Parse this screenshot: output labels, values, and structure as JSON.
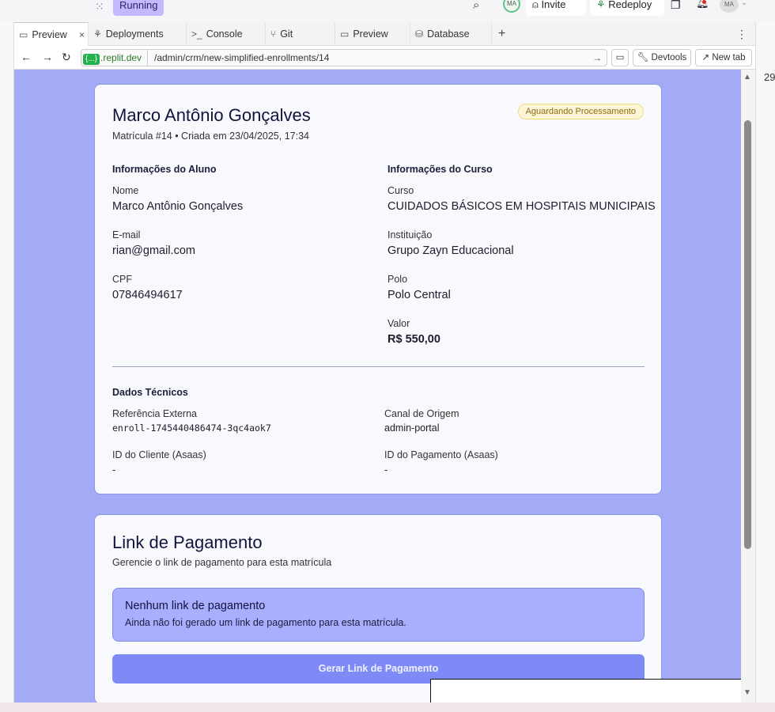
{
  "app": {
    "running_label": "Running",
    "avatar_initials": "MA",
    "invite_label": "Invite",
    "redeploy_label": "Redeploy"
  },
  "tabs": [
    {
      "label": "Preview",
      "icon": "monitor-icon",
      "active": true
    },
    {
      "label": "Deployments",
      "icon": "deploy-icon"
    },
    {
      "label": "Console",
      "icon": "terminal-icon"
    },
    {
      "label": "Git",
      "icon": "git-icon"
    },
    {
      "label": "Preview",
      "icon": "monitor-icon"
    },
    {
      "label": "Database",
      "icon": "database-icon"
    }
  ],
  "addressbar": {
    "domain_badge": "{...}",
    "domain": ".replit.dev",
    "path": "/admin/crm/new-simplified-enrollments/14",
    "devtools_label": "Devtools",
    "newtab_label": "New tab"
  },
  "side": {
    "right_number": "29"
  },
  "enrollment": {
    "student_name": "Marco Antônio Gonçalves",
    "subtitle": "Matrícula #14 • Criada em 23/04/2025, 17:34",
    "status": "Aguardando Processamento",
    "student_section": "Informações do Aluno",
    "course_section": "Informações do Curso",
    "name_label": "Nome",
    "name_value": "Marco Antônio Gonçalves",
    "email_label": "E-mail",
    "email_value": "rian@gmail.com",
    "cpf_label": "CPF",
    "cpf_value": "07846494617",
    "course_label": "Curso",
    "course_value": "CUIDADOS BÁSICOS EM HOSPITAIS MUNICIPAIS",
    "institution_label": "Instituição",
    "institution_value": "Grupo Zayn Educacional",
    "polo_label": "Polo",
    "polo_value": "Polo Central",
    "valor_label": "Valor",
    "valor_value": "R$ 550,00",
    "tech_section": "Dados Técnicos",
    "ext_ref_label": "Referência Externa",
    "ext_ref_value": "enroll-1745440486474-3qc4aok7",
    "channel_label": "Canal de Origem",
    "channel_value": "admin-portal",
    "client_id_label": "ID do Cliente (Asaas)",
    "client_id_value": "-",
    "payment_id_label": "ID do Pagamento (Asaas)",
    "payment_id_value": "-"
  },
  "payment": {
    "title": "Link de Pagamento",
    "subtitle": "Gerencie o link de pagamento para esta matrícula",
    "empty_title": "Nenhum link de pagamento",
    "empty_text": "Ainda não foi gerado um link de pagamento para esta matrícula.",
    "generate_button": "Gerar Link de Pagamento"
  }
}
